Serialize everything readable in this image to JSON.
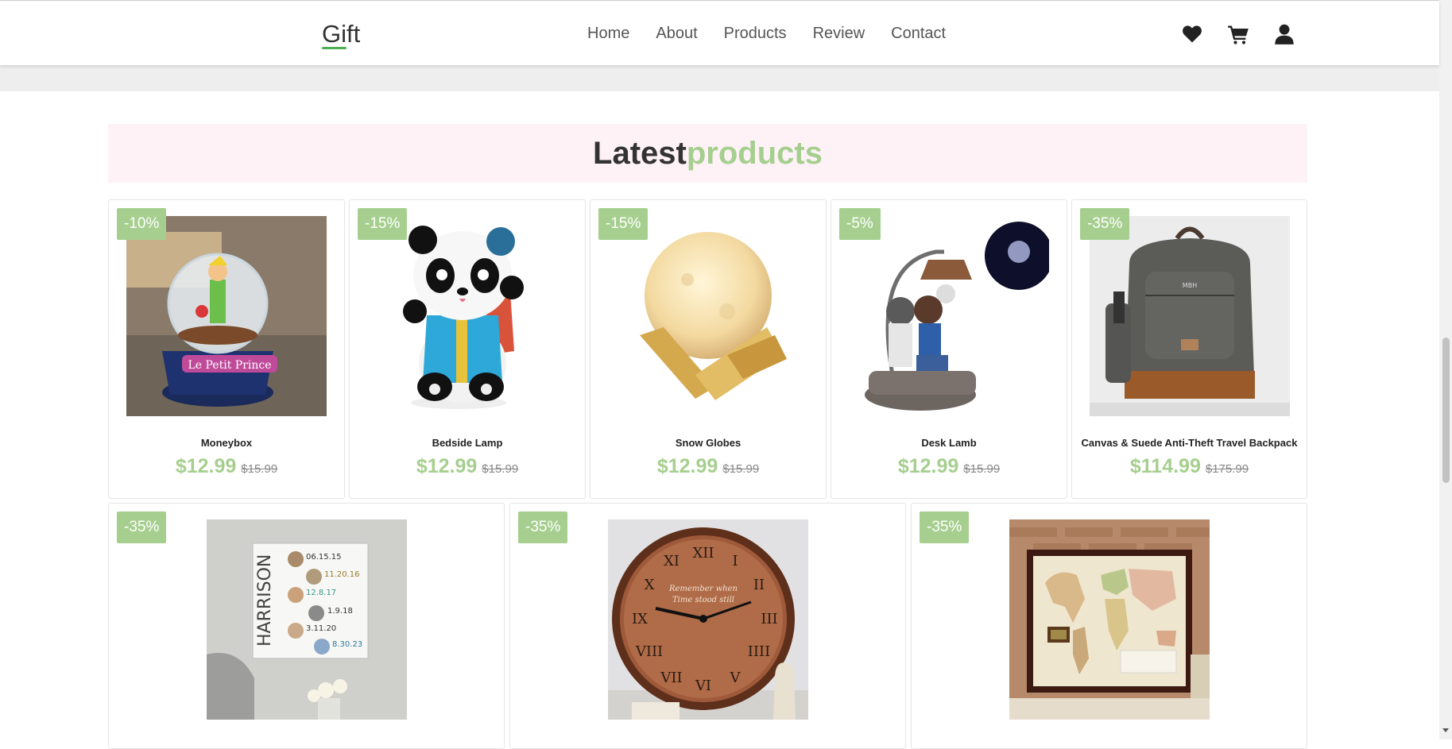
{
  "header": {
    "logo": "Gift",
    "nav": [
      "Home",
      "About",
      "Products",
      "Review",
      "Contact"
    ],
    "icons": [
      "heart-icon",
      "cart-icon",
      "user-icon"
    ]
  },
  "section": {
    "title_part1": "Latest",
    "title_part2": "products"
  },
  "colors": {
    "accent": "#a6cf8f",
    "title_bg": "#fff2f7",
    "logo_underline": "#4caf50"
  },
  "products_row1": [
    {
      "discount": "-10%",
      "name": "Moneybox",
      "price": "$12.99",
      "old_price": "$15.99"
    },
    {
      "discount": "-15%",
      "name": "Bedside Lamp",
      "price": "$12.99",
      "old_price": "$15.99"
    },
    {
      "discount": "-15%",
      "name": "Snow Globes",
      "price": "$12.99",
      "old_price": "$15.99"
    },
    {
      "discount": "-5%",
      "name": "Desk Lamb",
      "price": "$12.99",
      "old_price": "$15.99"
    },
    {
      "discount": "-35%",
      "name": "Canvas & Suede Anti-Theft Travel Backpack",
      "price": "$114.99",
      "old_price": "$175.99"
    }
  ],
  "products_row2": [
    {
      "discount": "-35%",
      "photo_text": [
        "HARRISON",
        "06.15.15",
        "11.20.16",
        "12.8.17",
        "1.9.18",
        "3.11.20",
        "8.30.23"
      ]
    },
    {
      "discount": "-35%",
      "photo_text": [
        "Remember when",
        "Time stood still"
      ]
    },
    {
      "discount": "-35%"
    }
  ]
}
